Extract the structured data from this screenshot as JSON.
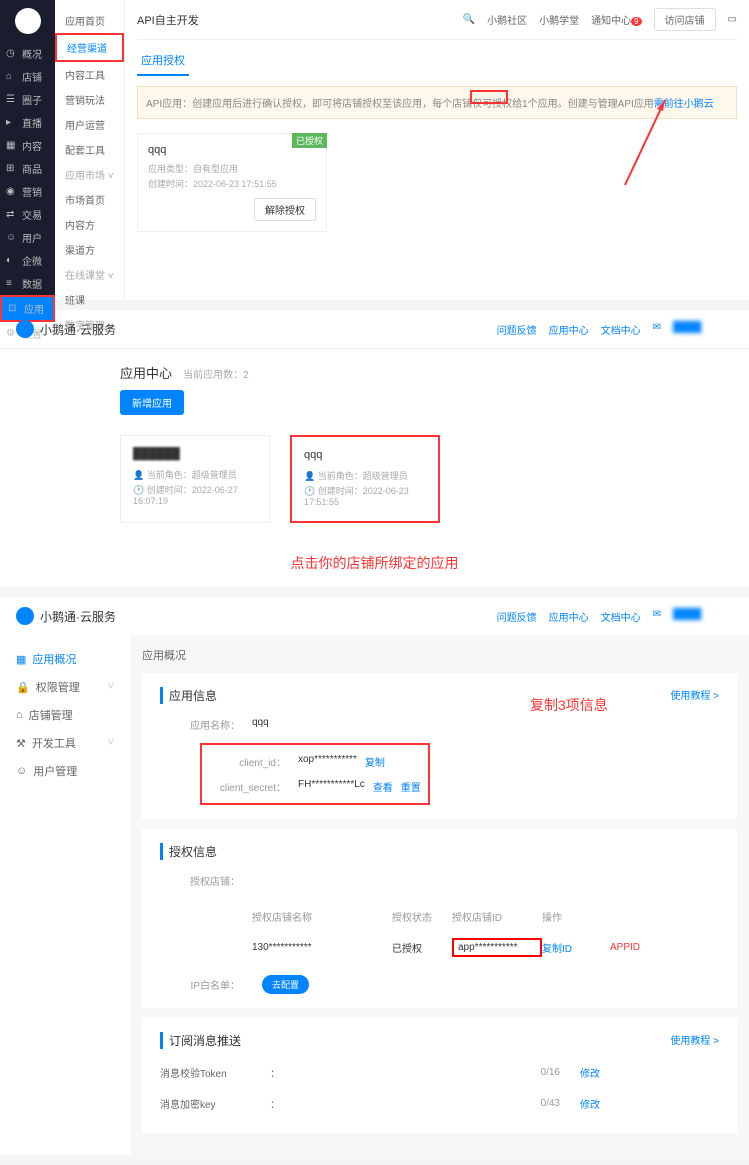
{
  "p1": {
    "sidebar_items": [
      "概况",
      "店铺",
      "圈子",
      "直播",
      "内容",
      "商品",
      "营销",
      "交易",
      "用户",
      "企微",
      "数据",
      "应用",
      "设置"
    ],
    "sub_top": "应用首页",
    "sub_hl": "经营渠道",
    "sub_items": [
      "内容工具",
      "营销玩法",
      "用户运营",
      "配套工具"
    ],
    "sub_group1": "应用市场",
    "sub_g1_items": [
      "市场首页",
      "内容方",
      "渠道方"
    ],
    "sub_group2": "在线课堂",
    "sub_g2_items": [
      "班课"
    ],
    "sub_group3": "数字管理",
    "title": "API自主开发",
    "header_links": [
      "小鹅社区",
      "小鹅学堂",
      "通知中心"
    ],
    "visit": "访问店铺",
    "tab": "应用授权",
    "notice_pre": "API应用：创建应用后进行确认授权，即可将店铺授权至该应用，每个店铺仅可授权给1个应用。创建与管理API应用",
    "notice_link": "需前往小鹅云",
    "card": {
      "badge": "已授权",
      "title": "qqq",
      "type_label": "应用类型：",
      "type_val": "自有型应用",
      "time_label": "创建时间：",
      "time_val": "2022-06-23 17:51:55",
      "btn": "解除授权"
    }
  },
  "p2": {
    "brand": "小鹅通·云服务",
    "links": [
      "问题反馈",
      "应用中心",
      "文档中心"
    ],
    "title": "应用中心",
    "count_label": "当前应用数：",
    "count": "2",
    "add": "新增应用",
    "card1": {
      "owner_label": "当前角色：",
      "owner": "超级管理员",
      "time_label": "创建时间：",
      "time": "2022-06-27 16:07:19"
    },
    "card2": {
      "title": "qqq",
      "owner_label": "当前角色：",
      "owner": "超级管理员",
      "time_label": "创建时间：",
      "time": "2022-06-23 17:51:55"
    },
    "annotation": "点击你的店铺所绑定的应用"
  },
  "p3": {
    "brand": "小鹅通·云服务",
    "links": [
      "问题反馈",
      "应用中心",
      "文档中心"
    ],
    "side": [
      "应用概况",
      "权限管理",
      "店铺管理",
      "开发工具",
      "用户管理"
    ],
    "crumb": "应用概况",
    "sec1": {
      "title": "应用信息",
      "link": "使用教程 >",
      "name_label": "应用名称：",
      "name": "qqq",
      "cid_label": "client_id：",
      "cid": "xop***********",
      "cid_act": "复制",
      "cs_label": "client_secret：",
      "cs": "FH***********Lc",
      "cs_act1": "查看",
      "cs_act2": "重置"
    },
    "annotation": "复制3项信息",
    "sec2": {
      "title": "授权信息",
      "shop_label": "授权店铺：",
      "h1": "授权店铺名称",
      "h2": "授权状态",
      "h3": "授权店铺ID",
      "h4": "操作",
      "r1": "130***********",
      "r2": "已授权",
      "r3": "app***********",
      "r4": "复制ID",
      "appid": "APPID",
      "ip_label": "IP白名单：",
      "ip_btn": "去配置"
    },
    "sec3": {
      "title": "订阅消息推送",
      "link": "使用教程 >",
      "r1_label": "消息校验Token",
      "r1_val": "0/16",
      "r2_label": "消息加密key",
      "r2_val": "0/43",
      "act": "修改"
    }
  }
}
